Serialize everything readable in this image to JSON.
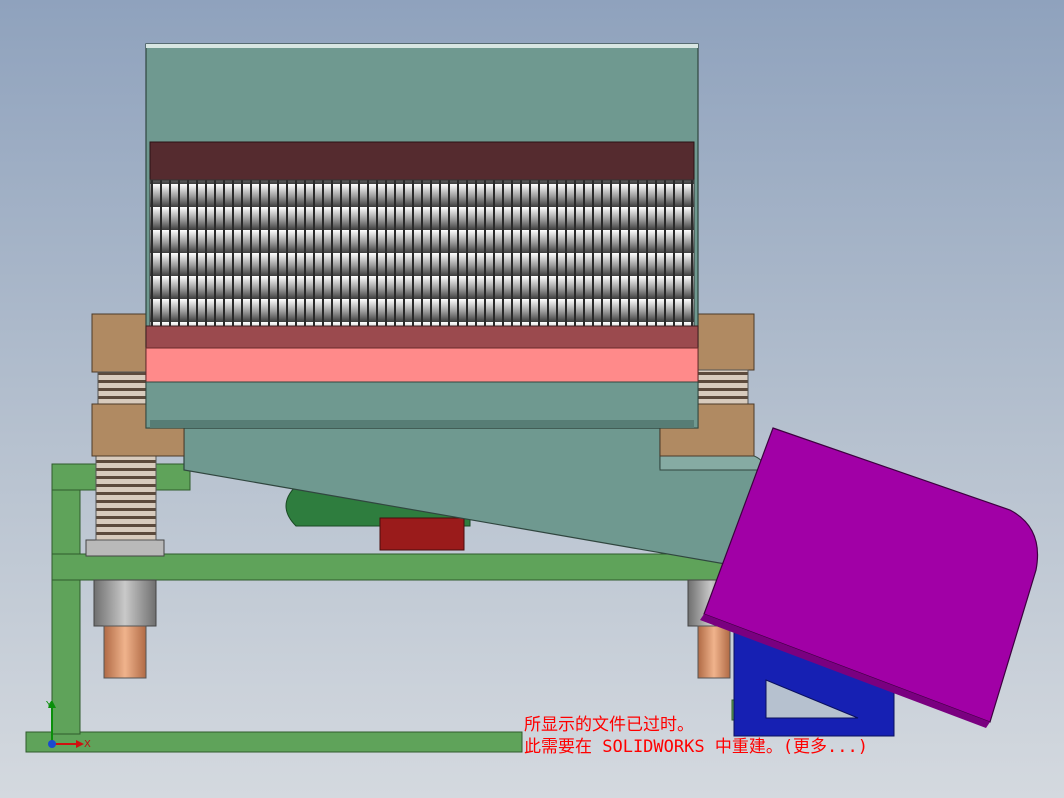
{
  "app": "SOLIDWORKS",
  "notice": {
    "line1": "所显示的文件已过时。",
    "line2": "此需要在 SOLIDWORKS 中重建。(更多...)"
  },
  "triad": {
    "x_label": "X",
    "y_label": "Y"
  },
  "colors": {
    "background_top": "#8fa2bd",
    "background_bottom": "#d4d9df",
    "hopper": "#6f9990",
    "frame": "#5fa35a",
    "spring_mount": "#b08a62",
    "screen_band": "#ff8a8a",
    "chute": "#a100a6",
    "support": "#1620b3",
    "motor": "#2e7d3e",
    "motor_box": "#9a1b1b",
    "notice_text": "#ff0000"
  }
}
